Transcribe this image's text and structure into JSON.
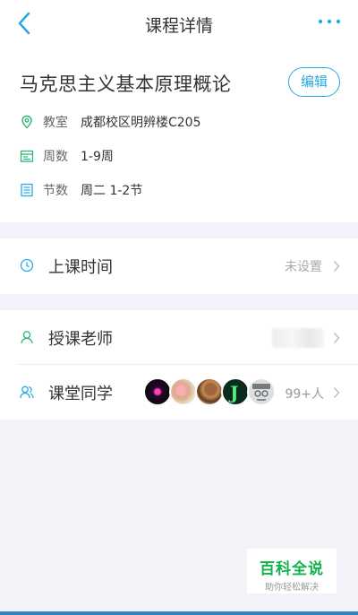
{
  "nav": {
    "title": "课程详情"
  },
  "course": {
    "name": "马克思主义基本原理概论",
    "edit_label": "编辑",
    "info": [
      {
        "label": "教室",
        "value": "成都校区明辨楼C205",
        "icon": "location-icon"
      },
      {
        "label": "周数",
        "value": "1-9周",
        "icon": "calendar-icon"
      },
      {
        "label": "节数",
        "value": "周二 1-2节",
        "icon": "list-icon"
      }
    ]
  },
  "schedule": {
    "title": "上课时间",
    "status": "未设置"
  },
  "teacher": {
    "title": "授课老师"
  },
  "classmates": {
    "title": "课堂同学",
    "count": "99+人"
  },
  "watermark": {
    "title": "百科全说",
    "subtitle": "助你轻松解决"
  },
  "colors": {
    "accent": "#27a9e3",
    "icon_green": "#2bb673",
    "background": "#f1f3f8"
  }
}
